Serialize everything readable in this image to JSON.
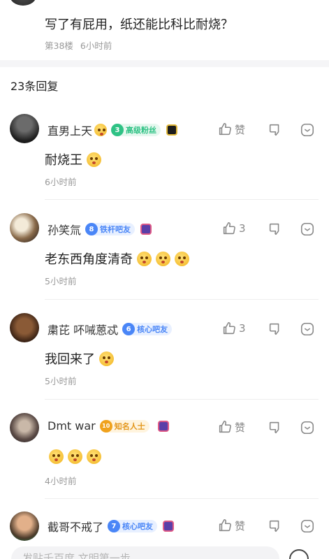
{
  "op_post": {
    "text": "写了有屁用，纸还能比科比耐烧？",
    "floor": "第38楼",
    "time": "6小时前"
  },
  "replies_header": "23条回复",
  "colors": {
    "level_green": "#2fc285",
    "level_blue": "#4a86f7",
    "level_gold": "#f0a21d",
    "muted_text": "#999999",
    "icon_gray": "#888888"
  },
  "comments": [
    {
      "username": "直男上天",
      "level": "3",
      "badge_text": "高级粉丝",
      "badge_color": "green",
      "like_label": "赞",
      "text": "耐烧王",
      "emoji_count": 1,
      "time": "6小时前"
    },
    {
      "username": "孙笑氚",
      "level": "8",
      "badge_text": "铁杆吧友",
      "badge_color": "blue",
      "like_label": "3",
      "text": "老东西角度清奇",
      "emoji_count": 3,
      "time": "5小时前"
    },
    {
      "username": "粛芘 吥㖑蒽忒",
      "level": "6",
      "badge_text": "核心吧友",
      "badge_color": "blue",
      "like_label": "3",
      "text": "我回来了",
      "emoji_count": 1,
      "time": "5小时前"
    },
    {
      "username": "Dmt war",
      "level": "10",
      "badge_text": "知名人士",
      "badge_color": "gold",
      "like_label": "赞",
      "text": "",
      "emoji_count": 3,
      "time": "4小时前"
    },
    {
      "username": "截哥不戒了",
      "level": "7",
      "badge_text": "核心吧友",
      "badge_color": "blue",
      "like_label": "赞",
      "text": "",
      "emoji_count": 0,
      "time": ""
    }
  ],
  "input": {
    "placeholder": "发贴千百度 文明第一步"
  }
}
